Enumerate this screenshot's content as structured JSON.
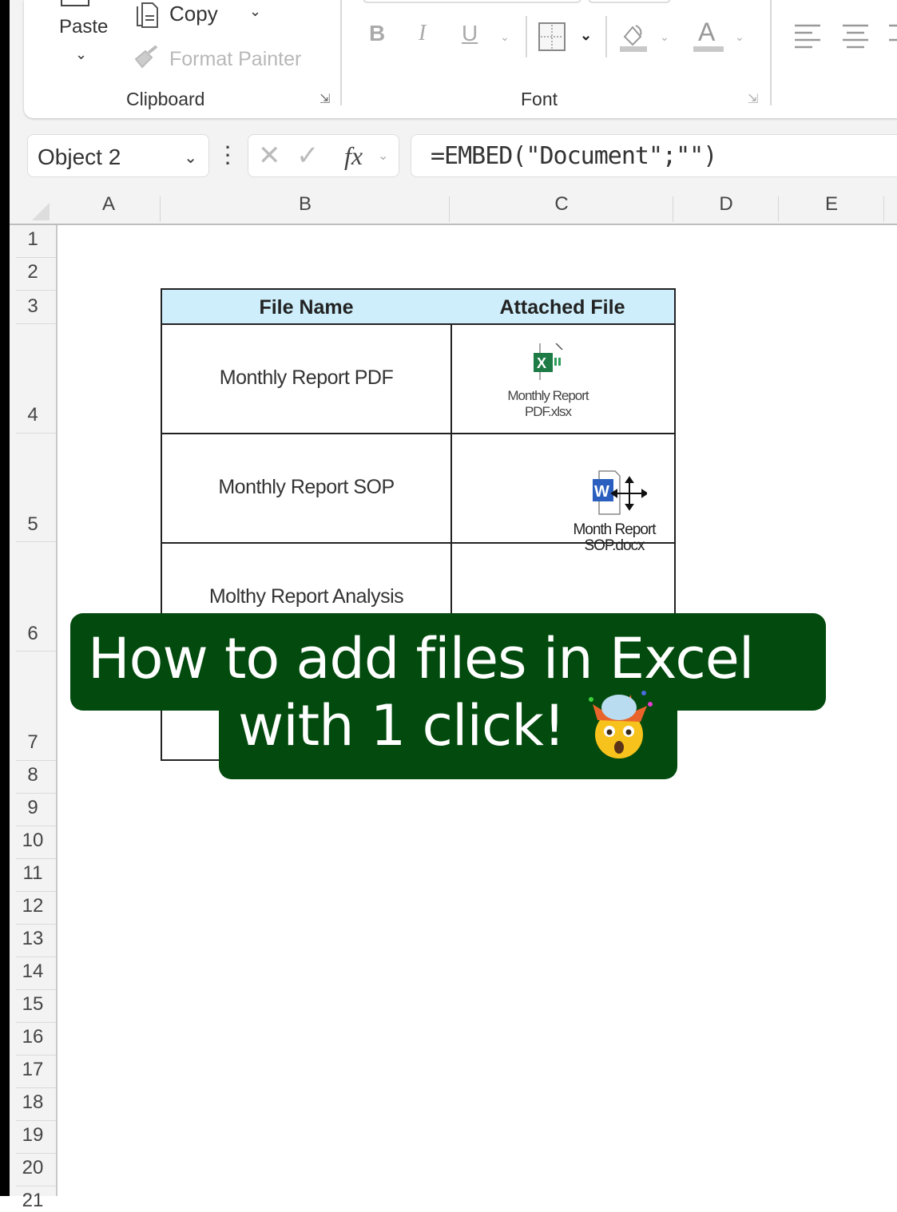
{
  "ribbon": {
    "clipboard": {
      "paste_label": "Paste",
      "copy_label": "Copy",
      "format_painter_label": "Format Painter",
      "group_label": "Clipboard"
    },
    "font": {
      "bold_label": "B",
      "italic_label": "I",
      "underline_label": "U",
      "font_color_label": "A",
      "group_label": "Font"
    }
  },
  "formula_bar": {
    "name_box": "Object 2",
    "fx_label": "fx",
    "cancel_symbol": "✕",
    "enter_symbol": "✓",
    "formula": "=EMBED(\"Document\";\"\")"
  },
  "grid": {
    "columns": [
      "A",
      "B",
      "C",
      "D",
      "E"
    ],
    "rows": [
      "1",
      "2",
      "3",
      "4",
      "5",
      "6",
      "7",
      "8",
      "9",
      "10",
      "11",
      "12",
      "13",
      "14",
      "15",
      "16",
      "17",
      "18",
      "19",
      "20",
      "21"
    ]
  },
  "table": {
    "headers": [
      "File Name",
      "Attached File"
    ],
    "rows": [
      {
        "file_name": "Monthly Report PDF",
        "attachment_caption_1": "Monthly Report",
        "attachment_caption_2": "PDF.xlsx",
        "attachment_type": "excel-file-icon"
      },
      {
        "file_name": "Monthly Report SOP",
        "attachment_caption_1": "Month Report",
        "attachment_caption_2": "SOP.docx",
        "attachment_type": "word-file-icon"
      },
      {
        "file_name": "Molthy Report Analysis",
        "attachment_caption_1": "",
        "attachment_caption_2": "",
        "attachment_type": ""
      }
    ]
  },
  "overlay": {
    "line1": "How to add files in Excel",
    "line2": "with 1 click!",
    "emoji": "exploding-head-emoji",
    "banner_color": "#024a0d"
  },
  "colors": {
    "header_fill": "#cdeefa",
    "excel_green": "#1e7b45",
    "word_blue": "#2b5fbf"
  }
}
